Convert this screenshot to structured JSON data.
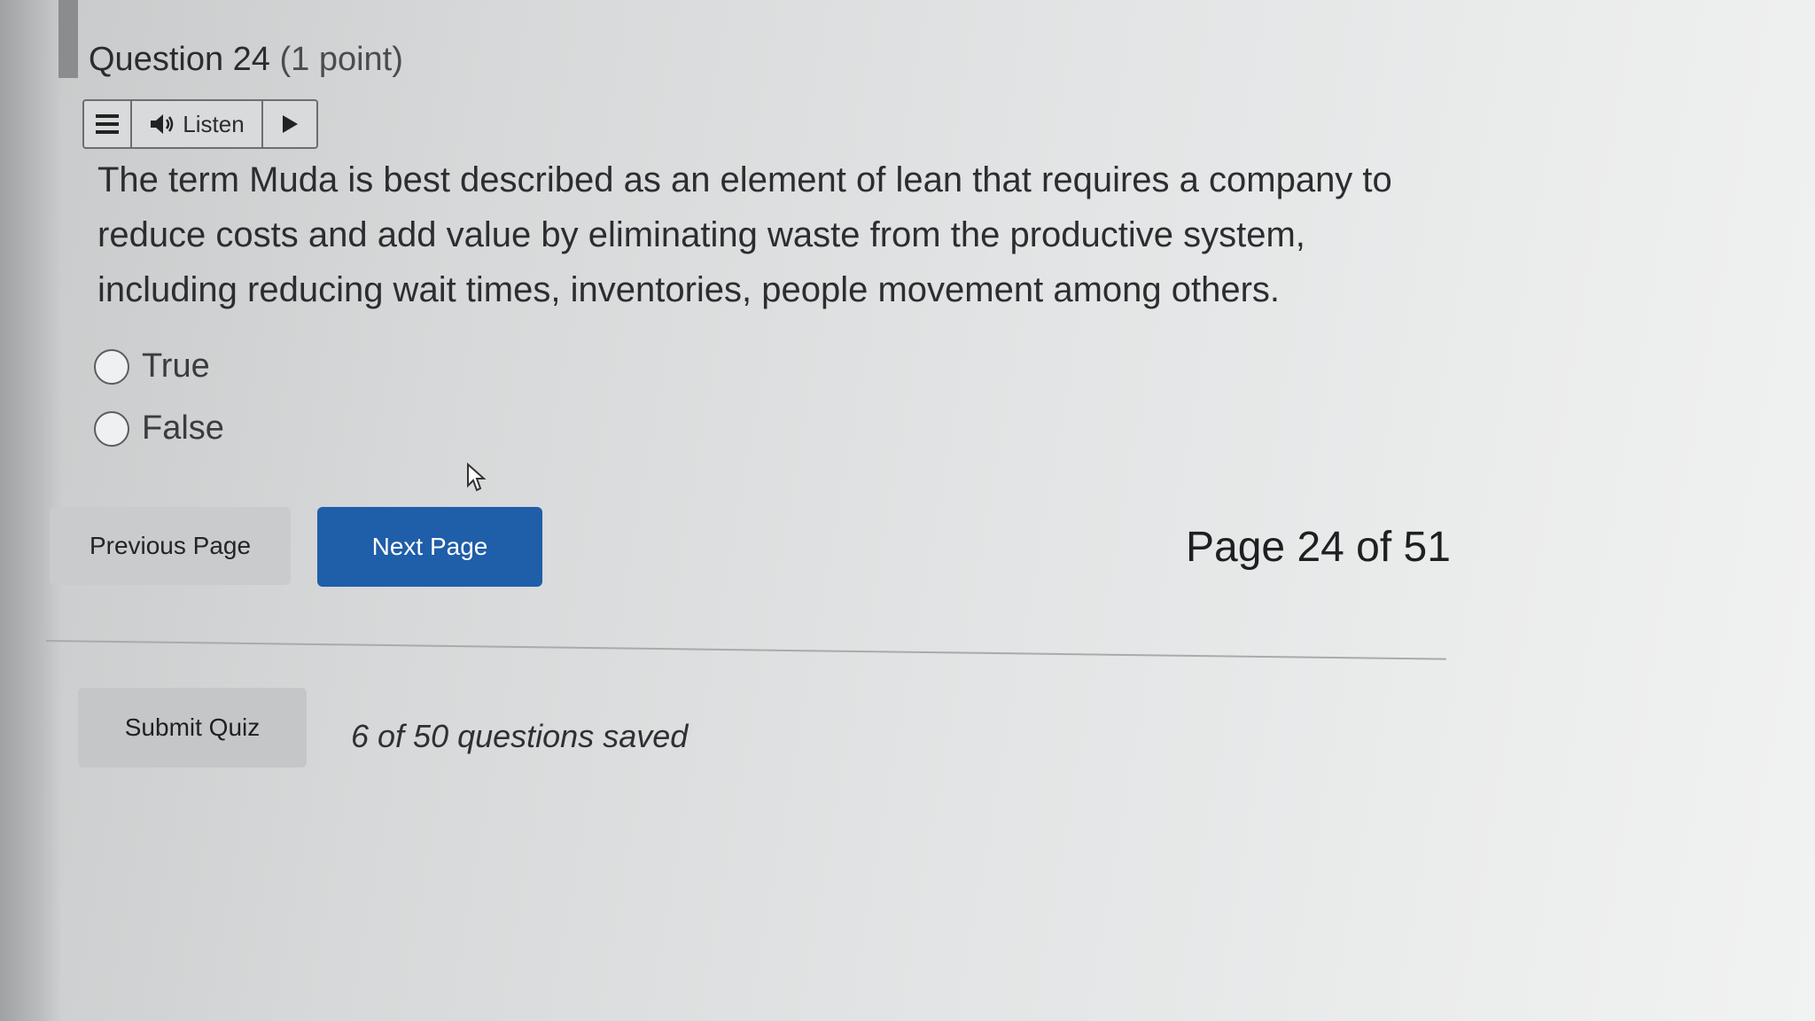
{
  "question": {
    "title": "Question 24",
    "points": "(1 point)",
    "text": "The term Muda is best described as an element of lean that requires a company to reduce costs and add value by eliminating waste from the productive system, including reducing wait times, inventories, people movement among others."
  },
  "toolbar": {
    "menu_icon": "menu-icon",
    "speaker_icon": "speaker-icon",
    "listen_label": "Listen",
    "play_icon": "play-icon"
  },
  "options": [
    {
      "label": "True",
      "selected": false
    },
    {
      "label": "False",
      "selected": false
    }
  ],
  "navigation": {
    "previous_label": "Previous Page",
    "next_label": "Next Page",
    "page_indicator": "Page 24 of 51"
  },
  "footer": {
    "submit_label": "Submit Quiz",
    "saved_status": "6 of 50 questions saved"
  },
  "colors": {
    "primary_button": "#1f5ea8",
    "secondary_button": "#c9cbcc"
  }
}
